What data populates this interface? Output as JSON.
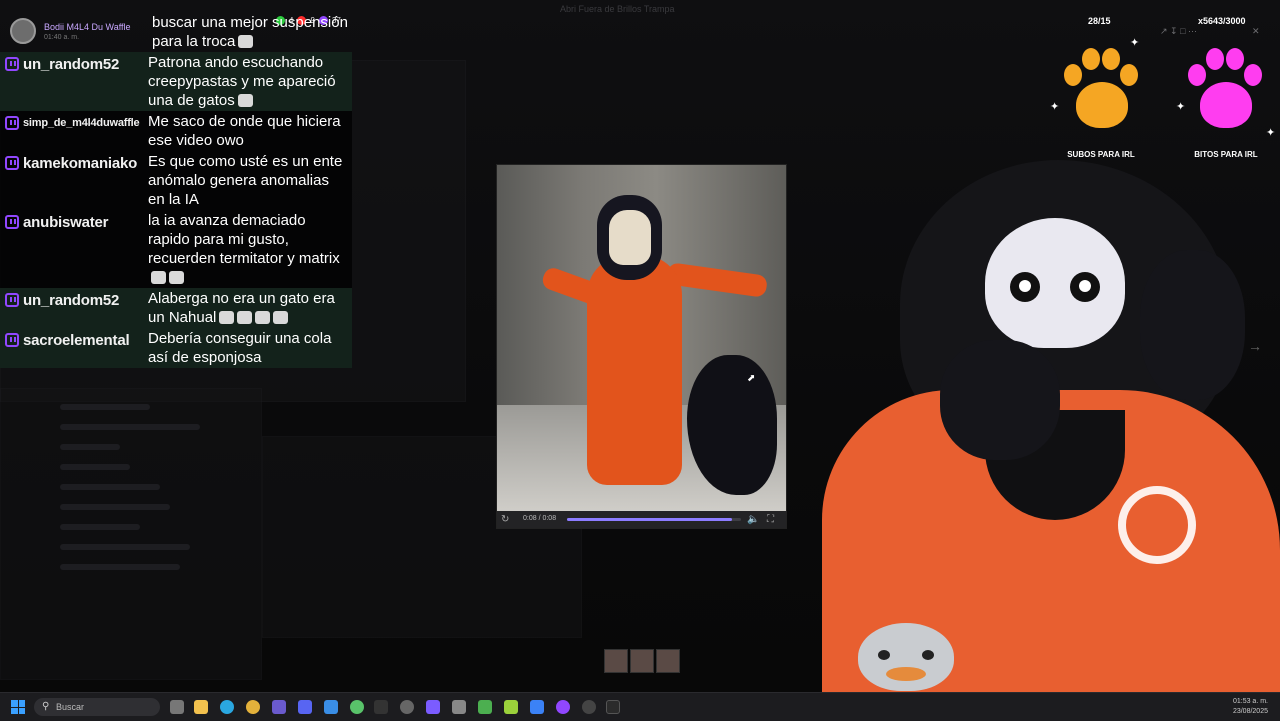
{
  "window": {
    "title": "Abri Fuera de Brillos Trampa"
  },
  "chat": {
    "header": {
      "name": "Bodii M4L4 Du Waffle",
      "sub": "01:40 a. m.",
      "counts": [
        "4",
        "9",
        "37"
      ]
    },
    "messages": [
      {
        "user": "",
        "text": "buscar una mejor suspensión para la troca",
        "style": "dark",
        "badge": false
      },
      {
        "user": "un_random52",
        "text": "Patrona ando escuchando creepypastas y me apareció una de gatos",
        "style": "hl",
        "badge": true
      },
      {
        "user": "simp_de_m4l4duwaffle",
        "text": "Me saco de onde que hiciera ese video owo",
        "style": "dark",
        "badge": true,
        "small": true
      },
      {
        "user": "kamekomaniako",
        "text": "Es que como usté es un ente anómalo genera anomalias en la IA",
        "style": "dark",
        "badge": true
      },
      {
        "user": "anubiswater",
        "text": "la ia avanza demaciado rapido para mi gusto, recuerden termitator y matrix",
        "style": "dark",
        "badge": true
      },
      {
        "user": "un_random52",
        "text": "Alaberga no era un gato era un Nahual",
        "style": "hl",
        "badge": true
      },
      {
        "user": "sacroelemental",
        "text": "Debería conseguir una cola así de esponjosa",
        "style": "hl",
        "badge": true
      }
    ]
  },
  "video": {
    "timecode": "0:08 / 0:08",
    "progress": 0.95
  },
  "widgets": {
    "subs_count": "28/15",
    "bits_count": "x5643/3000",
    "subs_label": "SUBOS PARA IRL",
    "bits_label": "BITOS PARA IRL",
    "colors": {
      "subs_paw": "#f5a623",
      "bits_paw": "#ff3df0",
      "chat_badge": "#9147ff",
      "overall_suit": "#e85f30"
    }
  },
  "taskbar": {
    "search_placeholder": "Buscar",
    "clock_time": "01:53 a. m.",
    "clock_date": "23/08/2025"
  }
}
